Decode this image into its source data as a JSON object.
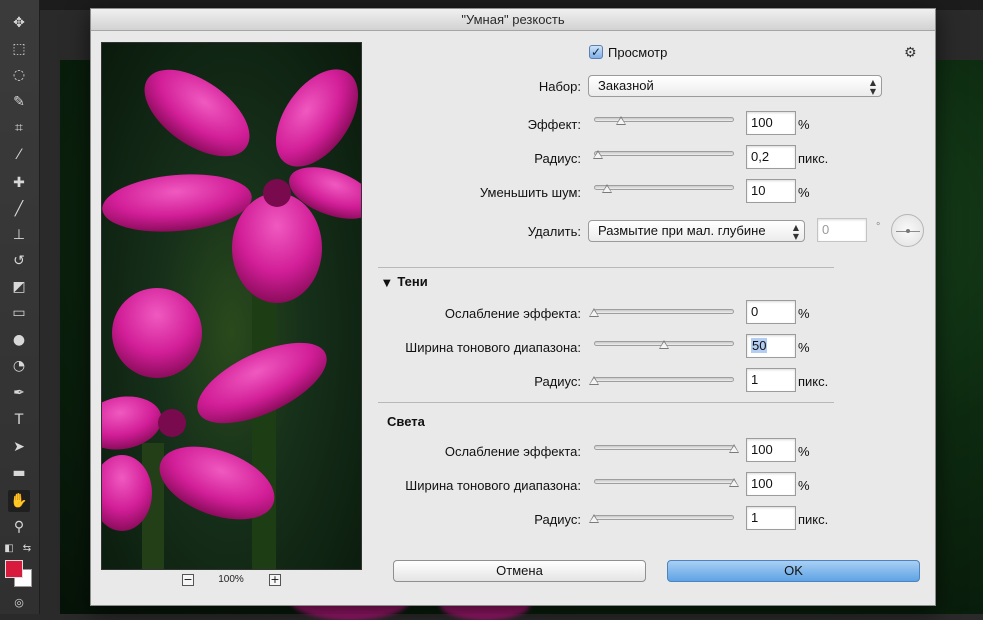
{
  "dialog": {
    "title": "\"Умная\" резкость",
    "preview_label": "Просмотр",
    "preview_checked": true,
    "zoom_level": "100%",
    "preset": {
      "label": "Набор:",
      "value": "Заказной"
    },
    "amount": {
      "label": "Эффект:",
      "value": "100",
      "unit": "%",
      "slider": 0.19
    },
    "radius": {
      "label": "Радиус:",
      "value": "0,2",
      "unit": "пикс.",
      "slider": 0.03
    },
    "noise": {
      "label": "Уменьшить шум:",
      "value": "10",
      "unit": "%",
      "slider": 0.09
    },
    "remove": {
      "label": "Удалить:",
      "value": "Размытие при мал. глубине",
      "angle": "0",
      "angle_unit": "°"
    },
    "shadows": {
      "title": "Тени",
      "fade": {
        "label": "Ослабление эффекта:",
        "value": "0",
        "unit": "%",
        "slider": 0.0
      },
      "tonal_width": {
        "label": "Ширина тонового диапазона:",
        "value": "50",
        "unit": "%",
        "slider": 0.5
      },
      "radius": {
        "label": "Радиус:",
        "value": "1",
        "unit": "пикс.",
        "slider": 0.0
      }
    },
    "highlights": {
      "title": "Света",
      "fade": {
        "label": "Ослабление эффекта:",
        "value": "100",
        "unit": "%",
        "slider": 1.0
      },
      "tonal_width": {
        "label": "Ширина тонового диапазона:",
        "value": "100",
        "unit": "%",
        "slider": 1.0
      },
      "radius": {
        "label": "Радиус:",
        "value": "1",
        "unit": "пикс.",
        "slider": 0.0
      }
    },
    "cancel_label": "Отмена",
    "ok_label": "OK"
  },
  "colors": {
    "foreground": "#d81b3c",
    "background": "#ffffff",
    "ok_button": "#5ea3e6"
  },
  "toolbar_icons": [
    "move-icon",
    "marquee-icon",
    "lasso-icon",
    "quick-select-icon",
    "crop-icon",
    "eyedropper-icon",
    "healing-icon",
    "brush-icon",
    "stamp-icon",
    "history-brush-icon",
    "eraser-icon",
    "gradient-icon",
    "blur-icon",
    "dodge-icon",
    "pen-icon",
    "type-icon",
    "path-select-icon",
    "shape-icon",
    "hand-icon",
    "zoom-icon"
  ]
}
